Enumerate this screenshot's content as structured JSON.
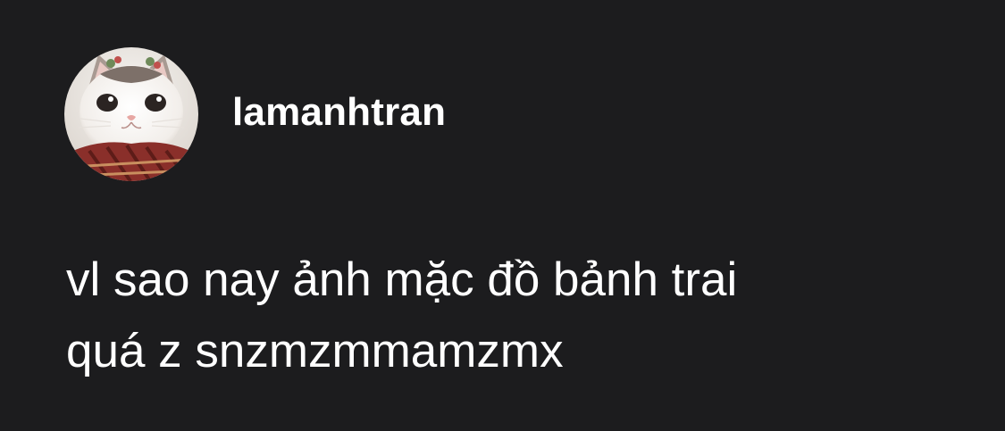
{
  "post": {
    "author": {
      "username": "lamanhtran",
      "avatar_icon": "cat-avatar-icon"
    },
    "comment_lines": [
      "vl sao nay ảnh mặc đồ bảnh trai",
      "quá z snzmzmmamzmx"
    ]
  },
  "colors": {
    "background": "#1c1c1e",
    "text": "#ffffff"
  }
}
